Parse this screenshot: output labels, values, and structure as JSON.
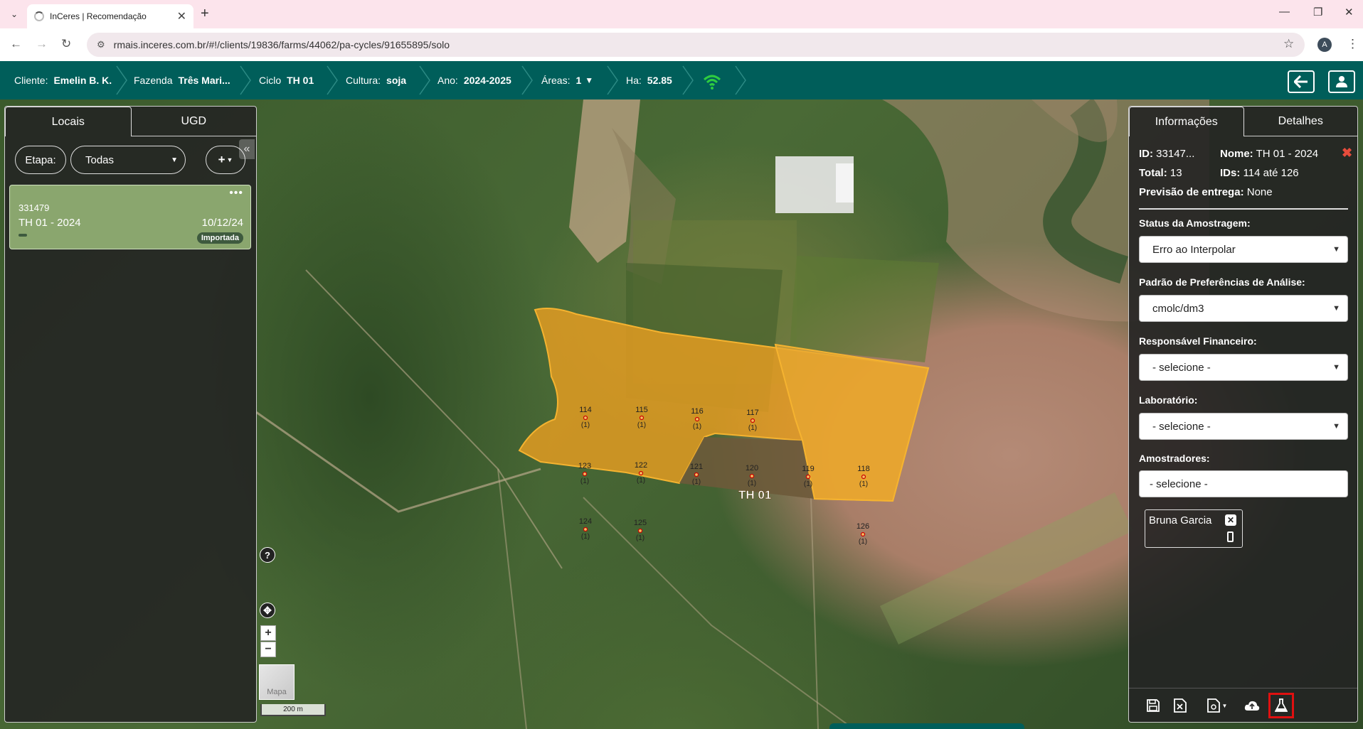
{
  "browser": {
    "tab_title": "InCeres | Recomendação",
    "url": "rmais.inceres.com.br/#!/clients/19836/farms/44062/pa-cycles/91655895/solo",
    "profile_initial": "A"
  },
  "appbar": {
    "cliente_label": "Cliente:",
    "cliente_value": "Emelin B. K.",
    "fazenda_label": "Fazenda",
    "fazenda_value": "Três Mari...",
    "ciclo_label": "Ciclo",
    "ciclo_value": "TH 01",
    "cultura_label": "Cultura:",
    "cultura_value": "soja",
    "ano_label": "Ano:",
    "ano_value": "2024-2025",
    "areas_label": "Áreas:",
    "areas_value": "1",
    "ha_label": "Ha:",
    "ha_value": "52.85",
    "accent": "#005e5a",
    "wifi_color": "#2ecc40"
  },
  "left": {
    "tabs": [
      "Locais",
      "UGD"
    ],
    "etapa_label": "Etapa:",
    "etapa_value": "Todas",
    "add_label": "+",
    "card": {
      "id": "331479",
      "name": "TH 01 - 2024",
      "date": "10/12/24",
      "badge": "Importada"
    }
  },
  "map": {
    "field_label": "TH 01",
    "field_color": "#f0a020",
    "points": [
      {
        "id": "114",
        "count": "(1)"
      },
      {
        "id": "115",
        "count": "(1)"
      },
      {
        "id": "116",
        "count": "(1)"
      },
      {
        "id": "117",
        "count": "(1)"
      },
      {
        "id": "123",
        "count": "(1)"
      },
      {
        "id": "122",
        "count": "(1)"
      },
      {
        "id": "121",
        "count": "(1)"
      },
      {
        "id": "120",
        "count": "(1)"
      },
      {
        "id": "119",
        "count": "(1)"
      },
      {
        "id": "118",
        "count": "(1)"
      },
      {
        "id": "124",
        "count": "(1)"
      },
      {
        "id": "125",
        "count": "(1)"
      },
      {
        "id": "126",
        "count": "(1)"
      }
    ],
    "help": "?",
    "zoom_in": "+",
    "zoom_out": "−",
    "layer_label": "Mapa",
    "scale_label": "200 m"
  },
  "right": {
    "tabs": [
      "Informações",
      "Detalhes"
    ],
    "id_label": "ID:",
    "id_value": "33147...",
    "nome_label": "Nome:",
    "nome_value": "TH 01 - 2024",
    "total_label": "Total:",
    "total_value": "13",
    "ids_label": "IDs:",
    "ids_value": "114 até 126",
    "previsao_label": "Previsão de entrega:",
    "previsao_value": "None",
    "status_label": "Status da Amostragem:",
    "status_value": "Erro ao Interpolar",
    "padrao_label": "Padrão de Preferências de Análise:",
    "padrao_value": "cmolc/dm3",
    "responsavel_label": "Responsável Financeiro:",
    "responsavel_value": "- selecione -",
    "laboratorio_label": "Laboratório:",
    "laboratorio_value": "- selecione -",
    "amostradores_label": "Amostradores:",
    "amostradores_value": "- selecione -",
    "amostrador_chip": "Bruna Garcia",
    "close_color": "#e74c3c",
    "highlight_color": "#e01010"
  }
}
